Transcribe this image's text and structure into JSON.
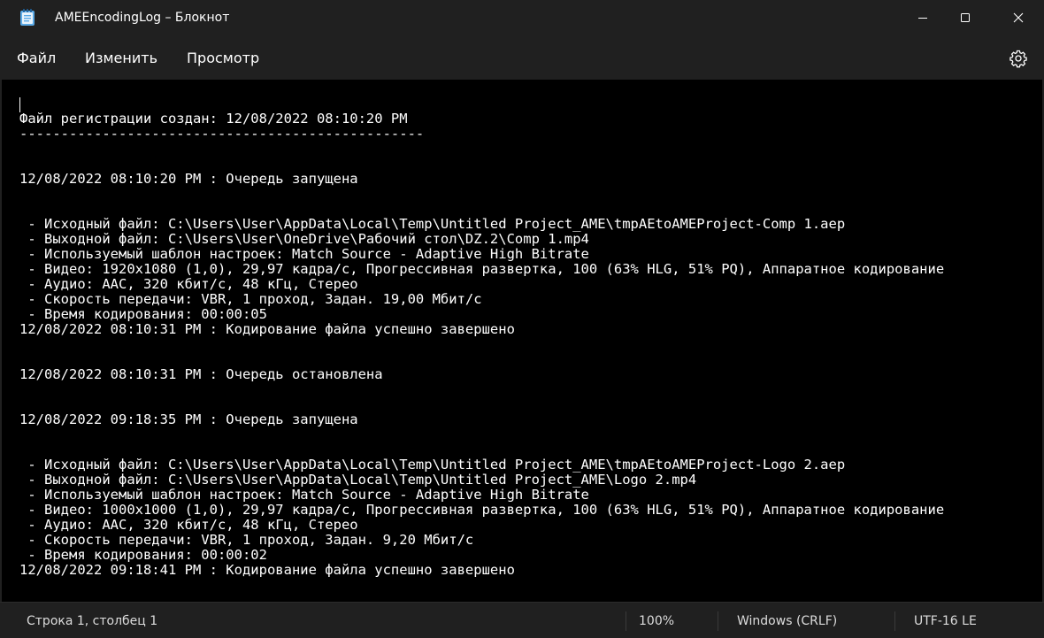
{
  "window": {
    "title": "AMEEncodingLog – Блокнот",
    "icon": "notepad-icon",
    "controls": [
      "minimize-icon",
      "maximize-icon",
      "close-icon"
    ]
  },
  "menu": {
    "file": "Файл",
    "edit": "Изменить",
    "view": "Просмотр",
    "settings_icon": "gear-icon"
  },
  "editor": {
    "content": "Файл регистрации создан: 12/08/2022 08:10:20 PM\n-------------------------------------------------\n\n\n12/08/2022 08:10:20 PM : Очередь запущена\n\n\n - Исходный файл: C:\\Users\\User\\AppData\\Local\\Temp\\Untitled Project_AME\\tmpAEtoAMEProject-Comp 1.aep\n - Выходной файл: C:\\Users\\User\\OneDrive\\Рабочий стол\\DZ.2\\Comp 1.mp4\n - Используемый шаблон настроек: Match Source - Adaptive High Bitrate\n - Видео: 1920x1080 (1,0), 29,97 кадра/с, Прогрессивная развертка, 100 (63% HLG, 51% PQ), Аппаратное кодирование\n - Аудио: AAC, 320 кбит/с, 48 кГц, Стерео\n - Скорость передачи: VBR, 1 проход, Задан. 19,00 Мбит/с\n - Время кодирования: 00:00:05\n12/08/2022 08:10:31 PM : Кодирование файла успешно завершено\n\n\n12/08/2022 08:10:31 PM : Очередь остановлена\n\n\n12/08/2022 09:18:35 PM : Очередь запущена\n\n\n - Исходный файл: C:\\Users\\User\\AppData\\Local\\Temp\\Untitled Project_AME\\tmpAEtoAMEProject-Logo 2.aep\n - Выходной файл: C:\\Users\\User\\AppData\\Local\\Temp\\Untitled Project_AME\\Logo 2.mp4\n - Используемый шаблон настроек: Match Source - Adaptive High Bitrate\n - Видео: 1000x1000 (1,0), 29,97 кадра/с, Прогрессивная развертка, 100 (63% HLG, 51% PQ), Аппаратное кодирование\n - Аудио: AAC, 320 кбит/с, 48 кГц, Стерео\n - Скорость передачи: VBR, 1 проход, Задан. 9,20 Мбит/с\n - Время кодирования: 00:00:02\n12/08/2022 09:18:41 PM : Кодирование файла успешно завершено"
  },
  "status": {
    "position": "Строка 1, столбец 1",
    "zoom": "100%",
    "line_endings": "Windows (CRLF)",
    "encoding": "UTF-16 LE"
  },
  "colors": {
    "chrome": "#202020",
    "editor_bg": "#000000",
    "text": "#ffffff"
  }
}
